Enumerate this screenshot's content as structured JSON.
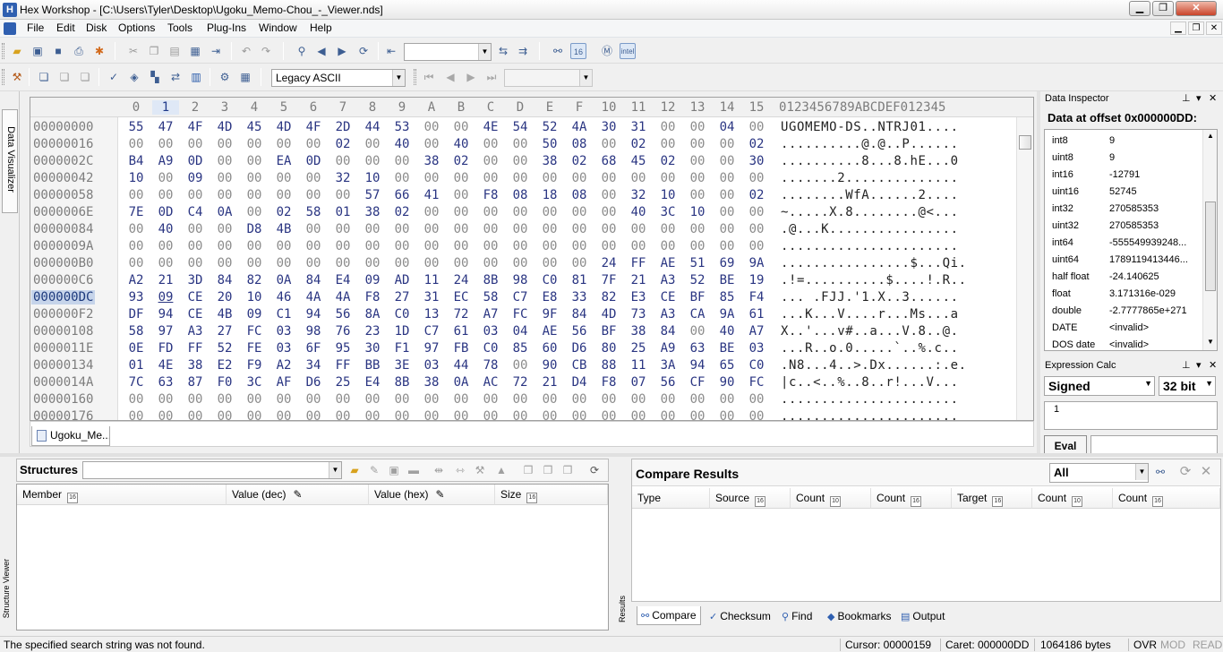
{
  "app": {
    "title": "Hex Workshop - [C:\\Users\\Tyler\\Desktop\\Ugoku_Memo-Chou_-_Viewer.nds]",
    "icon_letter": "H"
  },
  "menu": [
    "File",
    "Edit",
    "Disk",
    "Options",
    "Tools",
    "Plug-Ins",
    "Window",
    "Help"
  ],
  "toolbar": {
    "search_value": "",
    "encoding": "Legacy ASCII",
    "nav_value": ""
  },
  "side_tabs": {
    "data_visualizer": "Data Visualizer",
    "structure_viewer": "Structure Viewer",
    "results": "Results"
  },
  "hex": {
    "columns": [
      "0",
      "1",
      "2",
      "3",
      "4",
      "5",
      "6",
      "7",
      "8",
      "9",
      "A",
      "B",
      "C",
      "D",
      "E",
      "F",
      "10",
      "11",
      "12",
      "13",
      "14",
      "15"
    ],
    "selected_column": 1,
    "ascii_header": "0123456789ABCDEF012345",
    "rows": [
      {
        "offset": "00000000",
        "bytes": [
          "55",
          "47",
          "4F",
          "4D",
          "45",
          "4D",
          "4F",
          "2D",
          "44",
          "53",
          "00",
          "00",
          "4E",
          "54",
          "52",
          "4A",
          "30",
          "31",
          "00",
          "00",
          "04",
          "00"
        ],
        "ascii": "UGOMEMO-DS..NTRJ01...."
      },
      {
        "offset": "00000016",
        "bytes": [
          "00",
          "00",
          "00",
          "00",
          "00",
          "00",
          "00",
          "02",
          "00",
          "40",
          "00",
          "40",
          "00",
          "00",
          "50",
          "08",
          "00",
          "02",
          "00",
          "00",
          "00",
          "02"
        ],
        "ascii": "..........@.@..P......"
      },
      {
        "offset": "0000002C",
        "bytes": [
          "B4",
          "A9",
          "0D",
          "00",
          "00",
          "EA",
          "0D",
          "00",
          "00",
          "00",
          "38",
          "02",
          "00",
          "00",
          "38",
          "02",
          "68",
          "45",
          "02",
          "00",
          "00",
          "30"
        ],
        "ascii": "..........8...8.hE...0"
      },
      {
        "offset": "00000042",
        "bytes": [
          "10",
          "00",
          "09",
          "00",
          "00",
          "00",
          "00",
          "32",
          "10",
          "00",
          "00",
          "00",
          "00",
          "00",
          "00",
          "00",
          "00",
          "00",
          "00",
          "00",
          "00",
          "00"
        ],
        "ascii": ".......2.............."
      },
      {
        "offset": "00000058",
        "bytes": [
          "00",
          "00",
          "00",
          "00",
          "00",
          "00",
          "00",
          "00",
          "57",
          "66",
          "41",
          "00",
          "F8",
          "08",
          "18",
          "08",
          "00",
          "32",
          "10",
          "00",
          "00",
          "02"
        ],
        "ascii": "........WfA......2...."
      },
      {
        "offset": "0000006E",
        "bytes": [
          "7E",
          "0D",
          "C4",
          "0A",
          "00",
          "02",
          "58",
          "01",
          "38",
          "02",
          "00",
          "00",
          "00",
          "00",
          "00",
          "00",
          "00",
          "40",
          "3C",
          "10",
          "00",
          "00"
        ],
        "ascii": "~.....X.8........@<..."
      },
      {
        "offset": "00000084",
        "bytes": [
          "00",
          "40",
          "00",
          "00",
          "D8",
          "4B",
          "00",
          "00",
          "00",
          "00",
          "00",
          "00",
          "00",
          "00",
          "00",
          "00",
          "00",
          "00",
          "00",
          "00",
          "00",
          "00"
        ],
        "ascii": ".@...K................"
      },
      {
        "offset": "0000009A",
        "bytes": [
          "00",
          "00",
          "00",
          "00",
          "00",
          "00",
          "00",
          "00",
          "00",
          "00",
          "00",
          "00",
          "00",
          "00",
          "00",
          "00",
          "00",
          "00",
          "00",
          "00",
          "00",
          "00"
        ],
        "ascii": "......................"
      },
      {
        "offset": "000000B0",
        "bytes": [
          "00",
          "00",
          "00",
          "00",
          "00",
          "00",
          "00",
          "00",
          "00",
          "00",
          "00",
          "00",
          "00",
          "00",
          "00",
          "00",
          "24",
          "FF",
          "AE",
          "51",
          "69",
          "9A"
        ],
        "ascii": "................$...Qi."
      },
      {
        "offset": "000000C6",
        "bytes": [
          "A2",
          "21",
          "3D",
          "84",
          "82",
          "0A",
          "84",
          "E4",
          "09",
          "AD",
          "11",
          "24",
          "8B",
          "98",
          "C0",
          "81",
          "7F",
          "21",
          "A3",
          "52",
          "BE",
          "19"
        ],
        "ascii": ".!=..........$....!.R.."
      },
      {
        "offset": "000000DC",
        "bytes": [
          "93",
          "09",
          "CE",
          "20",
          "10",
          "46",
          "4A",
          "4A",
          "F8",
          "27",
          "31",
          "EC",
          "58",
          "C7",
          "E8",
          "33",
          "82",
          "E3",
          "CE",
          "BF",
          "85",
          "F4"
        ],
        "ascii": "... .FJJ.'1.X..3......"
      },
      {
        "offset": "000000F2",
        "bytes": [
          "DF",
          "94",
          "CE",
          "4B",
          "09",
          "C1",
          "94",
          "56",
          "8A",
          "C0",
          "13",
          "72",
          "A7",
          "FC",
          "9F",
          "84",
          "4D",
          "73",
          "A3",
          "CA",
          "9A",
          "61"
        ],
        "ascii": "...K...V....r...Ms...a"
      },
      {
        "offset": "00000108",
        "bytes": [
          "58",
          "97",
          "A3",
          "27",
          "FC",
          "03",
          "98",
          "76",
          "23",
          "1D",
          "C7",
          "61",
          "03",
          "04",
          "AE",
          "56",
          "BF",
          "38",
          "84",
          "00",
          "40",
          "A7"
        ],
        "ascii": "X..'...v#..a...V.8..@."
      },
      {
        "offset": "0000011E",
        "bytes": [
          "0E",
          "FD",
          "FF",
          "52",
          "FE",
          "03",
          "6F",
          "95",
          "30",
          "F1",
          "97",
          "FB",
          "C0",
          "85",
          "60",
          "D6",
          "80",
          "25",
          "A9",
          "63",
          "BE",
          "03"
        ],
        "ascii": "...R..o.0.....`..%.c.."
      },
      {
        "offset": "00000134",
        "bytes": [
          "01",
          "4E",
          "38",
          "E2",
          "F9",
          "A2",
          "34",
          "FF",
          "BB",
          "3E",
          "03",
          "44",
          "78",
          "00",
          "90",
          "CB",
          "88",
          "11",
          "3A",
          "94",
          "65",
          "C0"
        ],
        "ascii": ".N8...4..>.Dx......:.e."
      },
      {
        "offset": "0000014A",
        "bytes": [
          "7C",
          "63",
          "87",
          "F0",
          "3C",
          "AF",
          "D6",
          "25",
          "E4",
          "8B",
          "38",
          "0A",
          "AC",
          "72",
          "21",
          "D4",
          "F8",
          "07",
          "56",
          "CF",
          "90",
          "FC"
        ],
        "ascii": "|c..<..%..8..r!...V..."
      },
      {
        "offset": "00000160",
        "bytes": [
          "00",
          "00",
          "00",
          "00",
          "00",
          "00",
          "00",
          "00",
          "00",
          "00",
          "00",
          "00",
          "00",
          "00",
          "00",
          "00",
          "00",
          "00",
          "00",
          "00",
          "00",
          "00"
        ],
        "ascii": "......................"
      },
      {
        "offset": "00000176",
        "bytes": [
          "00",
          "00",
          "00",
          "00",
          "00",
          "00",
          "00",
          "00",
          "00",
          "00",
          "00",
          "00",
          "00",
          "00",
          "00",
          "00",
          "00",
          "00",
          "00",
          "00",
          "00",
          "00"
        ],
        "ascii": "......................"
      }
    ],
    "selected_offset": "000000DC",
    "cursor_byte_row": 10,
    "cursor_byte_col": 1,
    "document_tab": "Ugoku_Me..."
  },
  "data_inspector": {
    "title": "Data Inspector",
    "offset_label": "Data at offset 0x000000DD:",
    "rows": [
      {
        "k": "int8",
        "v": "9"
      },
      {
        "k": "uint8",
        "v": "9"
      },
      {
        "k": "int16",
        "v": "-12791"
      },
      {
        "k": "uint16",
        "v": "52745"
      },
      {
        "k": "int32",
        "v": "270585353"
      },
      {
        "k": "uint32",
        "v": "270585353"
      },
      {
        "k": "int64",
        "v": "-555549939248..."
      },
      {
        "k": "uint64",
        "v": "1789119413446..."
      },
      {
        "k": "half float",
        "v": "-24.140625"
      },
      {
        "k": "float",
        "v": "3.171316e-029"
      },
      {
        "k": "double",
        "v": "-2.7777865e+271"
      },
      {
        "k": "DATE",
        "v": "<invalid>"
      },
      {
        "k": "DOS date",
        "v": "<invalid>"
      }
    ]
  },
  "expression_calc": {
    "title": "Expression Calc",
    "sign": "Signed",
    "bits": "32 bit",
    "value": "1",
    "eval_label": "Eval"
  },
  "structures": {
    "label": "Structures",
    "columns": [
      "Member",
      "Value (dec)",
      "Value (hex)",
      "Size"
    ]
  },
  "compare": {
    "title": "Compare Results",
    "filter": "All",
    "columns": [
      "Type",
      "Source",
      "Count",
      "Count",
      "Target",
      "Count",
      "Count"
    ],
    "tabs": [
      "Compare",
      "Checksum",
      "Find",
      "Bookmarks",
      "Output"
    ]
  },
  "status": {
    "message": "The specified search string was not found.",
    "cursor": "Cursor: 00000159",
    "caret": "Caret: 000000DD",
    "size": "1064186 bytes",
    "ovr": "OVR",
    "mod": "MOD",
    "read": "READ"
  }
}
